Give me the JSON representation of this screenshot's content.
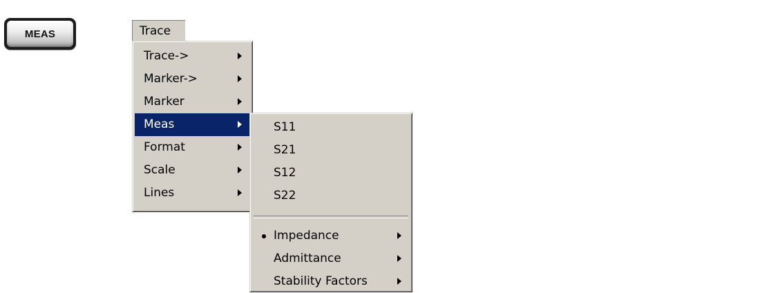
{
  "hardkey": {
    "label": "MEAS"
  },
  "menubar": {
    "title": "Trace"
  },
  "trace_menu": {
    "items": [
      {
        "label": "Trace->",
        "has_submenu": true,
        "selected": false
      },
      {
        "label": "Marker->",
        "has_submenu": true,
        "selected": false
      },
      {
        "label": "Marker",
        "has_submenu": true,
        "selected": false
      },
      {
        "label": "Meas",
        "has_submenu": true,
        "selected": true
      },
      {
        "label": "Format",
        "has_submenu": true,
        "selected": false
      },
      {
        "label": "Scale",
        "has_submenu": true,
        "selected": false
      },
      {
        "label": "Lines",
        "has_submenu": true,
        "selected": false
      }
    ]
  },
  "meas_menu": {
    "params": [
      {
        "label": "S11"
      },
      {
        "label": "S21"
      },
      {
        "label": "S12"
      },
      {
        "label": "S22"
      }
    ],
    "conversions": [
      {
        "label": "Impedance",
        "has_submenu": true,
        "checked": true
      },
      {
        "label": "Admittance",
        "has_submenu": true,
        "checked": false
      },
      {
        "label": "Stability Factors",
        "has_submenu": true,
        "checked": false
      }
    ]
  },
  "colors": {
    "menu_background": "#d4d0c8",
    "selection_highlight": "#0a246a",
    "selection_text": "#ffffff"
  },
  "icons": {
    "submenu": "submenu-arrow-icon",
    "checked": "radio-bullet-icon"
  }
}
